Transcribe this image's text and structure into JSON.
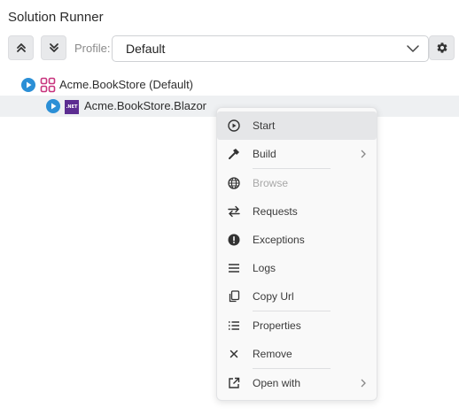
{
  "panel": {
    "title": "Solution Runner"
  },
  "toolbar": {
    "collapse_icon": "chevrons-up-icon",
    "expand_icon": "chevrons-down-icon",
    "profile_label": "Profile:",
    "profile_value": "Default",
    "settings_icon": "gear-icon"
  },
  "tree": {
    "solution": {
      "label": "Acme.BookStore (Default)",
      "icon": "solution-icon"
    },
    "project": {
      "label": "Acme.BookStore.Blazor",
      "icon": "dotnet-icon",
      "badge": ".NET"
    }
  },
  "menu": {
    "items": [
      {
        "label": "Start",
        "icon": "play-circle-icon",
        "enabled": true
      },
      {
        "label": "Build",
        "icon": "hammer-icon",
        "enabled": true,
        "submenu": true
      },
      {
        "label": "Browse",
        "icon": "globe-icon",
        "enabled": false
      },
      {
        "label": "Requests",
        "icon": "arrows-exchange-icon",
        "enabled": true
      },
      {
        "label": "Exceptions",
        "icon": "exclamation-circle-icon",
        "enabled": true
      },
      {
        "label": "Logs",
        "icon": "lines-icon",
        "enabled": true
      },
      {
        "label": "Copy Url",
        "icon": "copy-icon",
        "enabled": true
      },
      {
        "label": "Properties",
        "icon": "list-icon",
        "enabled": true
      },
      {
        "label": "Remove",
        "icon": "close-icon",
        "enabled": true
      },
      {
        "label": "Open with",
        "icon": "external-link-icon",
        "enabled": true,
        "submenu": true
      }
    ]
  },
  "colors": {
    "play": "#2b8fd6",
    "solution_icon": "#c8337d",
    "dotnet": "#5c2d91"
  }
}
